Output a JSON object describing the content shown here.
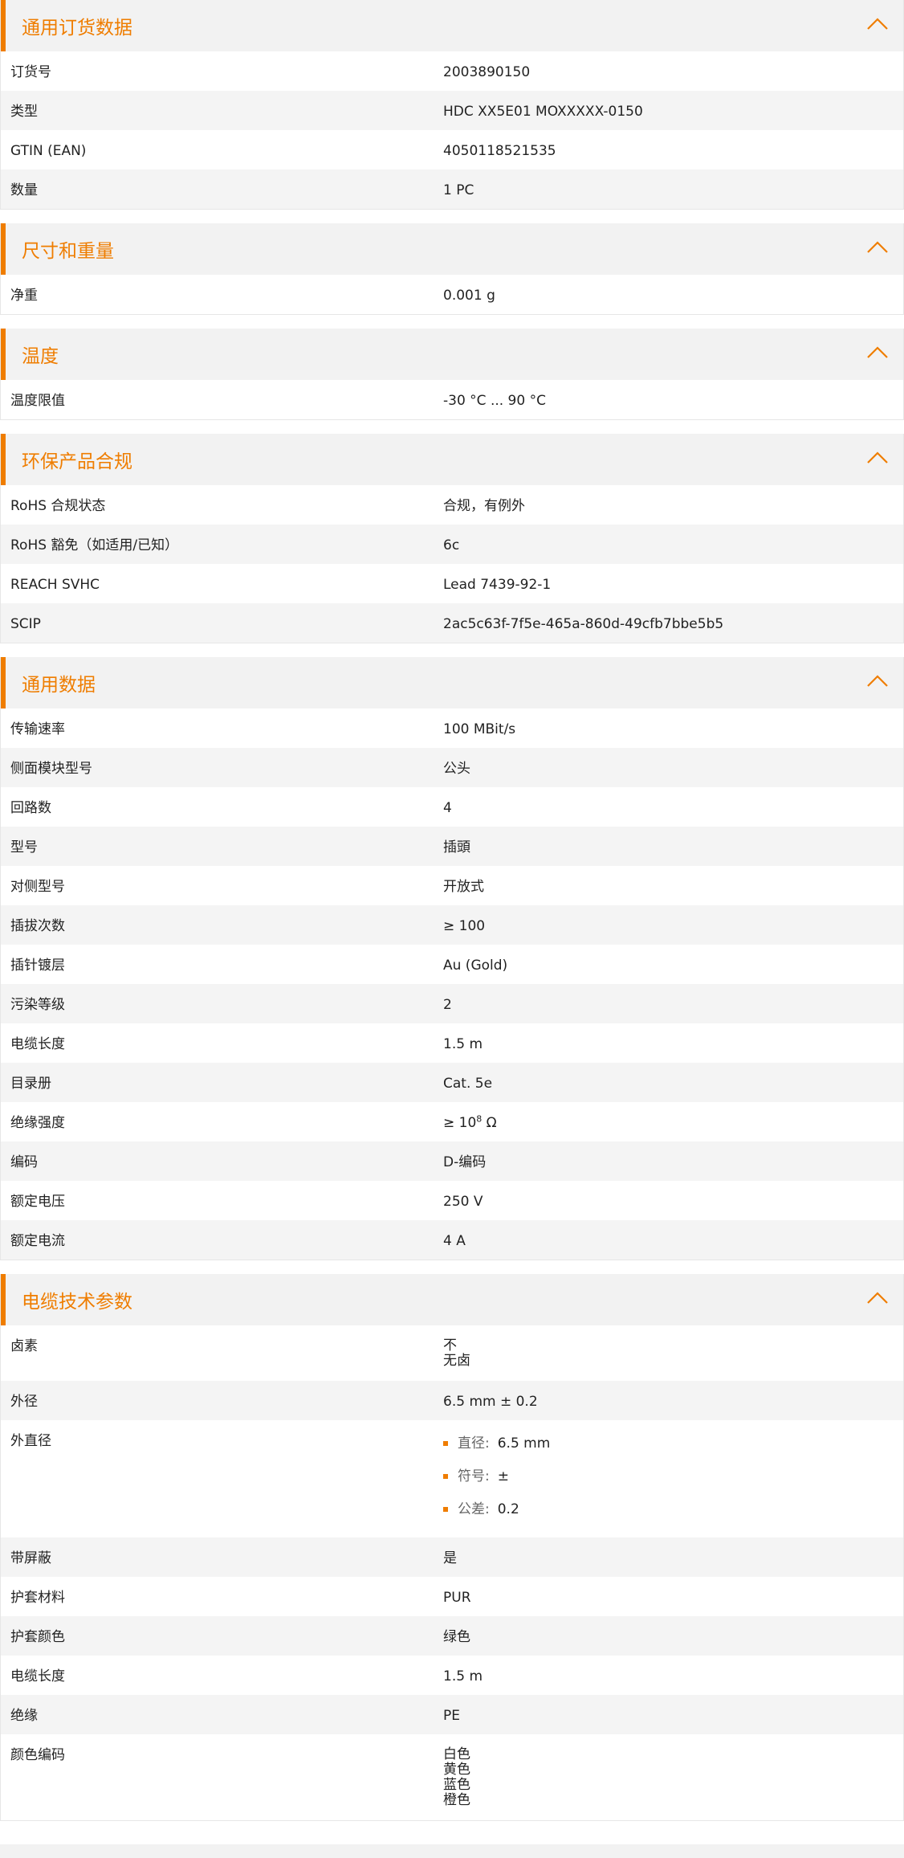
{
  "colors": {
    "accent": "#ef7d00",
    "header_bg": "#f2f2f2",
    "row_alt": "#f4f4f4"
  },
  "sections": [
    {
      "title": "通用订货数据",
      "rows": [
        {
          "label": "订货号",
          "value": "2003890150"
        },
        {
          "label": "类型",
          "value": "HDC XX5E01 MOXXXXX-0150"
        },
        {
          "label": "GTIN (EAN)",
          "value": "4050118521535"
        },
        {
          "label": "数量",
          "value": "1  PC"
        }
      ]
    },
    {
      "title": "尺寸和重量",
      "rows": [
        {
          "label": "净重",
          "value": "0.001  g"
        }
      ]
    },
    {
      "title": "温度",
      "rows": [
        {
          "label": "温度限值",
          "value": "-30 °C ... 90 °C"
        }
      ]
    },
    {
      "title": "环保产品合规",
      "rows": [
        {
          "label": "RoHS 合规状态",
          "value": "合规，有例外"
        },
        {
          "label": "RoHS 豁免（如适用/已知）",
          "value": "6c"
        },
        {
          "label": "REACH SVHC",
          "value": "Lead 7439-92-1"
        },
        {
          "label": "SCIP",
          "value": "2ac5c63f-7f5e-465a-860d-49cfb7bbe5b5"
        }
      ]
    },
    {
      "title": "通用数据",
      "rows": [
        {
          "label": "传输速率",
          "value": "100 MBit/s"
        },
        {
          "label": "侧面模块型号",
          "value": "公头"
        },
        {
          "label": "回路数",
          "value": "4"
        },
        {
          "label": "型号",
          "value": "插頭"
        },
        {
          "label": "对侧型号",
          "value": "开放式"
        },
        {
          "label": "插拔次数",
          "value": "≥ 100"
        },
        {
          "label": "插针镀层",
          "value": "Au (Gold)"
        },
        {
          "label": "污染等级",
          "value": "2"
        },
        {
          "label": "电缆长度",
          "value": "1.5  m"
        },
        {
          "label": "目录册",
          "value": "Cat. 5e"
        },
        {
          "label": "绝缘强度",
          "value_prefix": "≥ 10",
          "value_sup": "8",
          "value_suffix": " Ω"
        },
        {
          "label": "编码",
          "value": "D-编码"
        },
        {
          "label": "额定电压",
          "value": "250  V"
        },
        {
          "label": "额定电流",
          "value": "4  A"
        }
      ]
    },
    {
      "title": "电缆技术参数",
      "rows": [
        {
          "label": "卤素",
          "lines": [
            "不",
            "无卤"
          ]
        },
        {
          "label": "外径",
          "value": "6.5 mm ± 0.2"
        },
        {
          "label": "外直径",
          "bullets": [
            {
              "key": "直径:",
              "val": "6.5 mm"
            },
            {
              "key": "符号:",
              "val": "±"
            },
            {
              "key": "公差:",
              "val": "0.2"
            }
          ]
        },
        {
          "label": "带屏蔽",
          "value": "是"
        },
        {
          "label": "护套材料",
          "value": "PUR"
        },
        {
          "label": "护套颜色",
          "value": "绿色"
        },
        {
          "label": "电缆长度",
          "value": "1.5  m"
        },
        {
          "label": "绝缘",
          "value": "PE"
        },
        {
          "label": "颜色编码",
          "lines": [
            "白色",
            "黄色",
            "蓝色",
            "橙色"
          ]
        }
      ]
    }
  ]
}
